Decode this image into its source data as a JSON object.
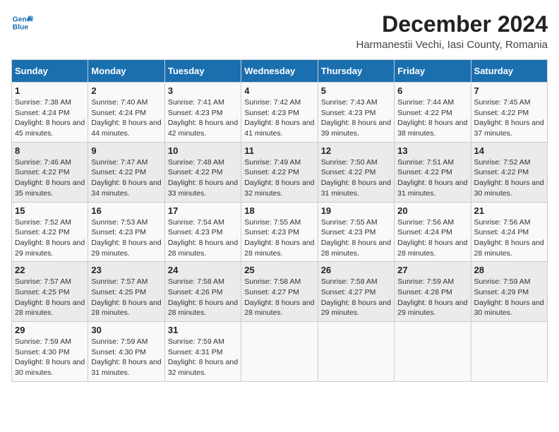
{
  "header": {
    "logo_line1": "General",
    "logo_line2": "Blue",
    "title": "December 2024",
    "subtitle": "Harmanestii Vechi, Iasi County, Romania"
  },
  "days_of_week": [
    "Sunday",
    "Monday",
    "Tuesday",
    "Wednesday",
    "Thursday",
    "Friday",
    "Saturday"
  ],
  "weeks": [
    [
      {
        "day": "1",
        "sunrise": "Sunrise: 7:38 AM",
        "sunset": "Sunset: 4:24 PM",
        "daylight": "Daylight: 8 hours and 45 minutes."
      },
      {
        "day": "2",
        "sunrise": "Sunrise: 7:40 AM",
        "sunset": "Sunset: 4:24 PM",
        "daylight": "Daylight: 8 hours and 44 minutes."
      },
      {
        "day": "3",
        "sunrise": "Sunrise: 7:41 AM",
        "sunset": "Sunset: 4:23 PM",
        "daylight": "Daylight: 8 hours and 42 minutes."
      },
      {
        "day": "4",
        "sunrise": "Sunrise: 7:42 AM",
        "sunset": "Sunset: 4:23 PM",
        "daylight": "Daylight: 8 hours and 41 minutes."
      },
      {
        "day": "5",
        "sunrise": "Sunrise: 7:43 AM",
        "sunset": "Sunset: 4:23 PM",
        "daylight": "Daylight: 8 hours and 39 minutes."
      },
      {
        "day": "6",
        "sunrise": "Sunrise: 7:44 AM",
        "sunset": "Sunset: 4:22 PM",
        "daylight": "Daylight: 8 hours and 38 minutes."
      },
      {
        "day": "7",
        "sunrise": "Sunrise: 7:45 AM",
        "sunset": "Sunset: 4:22 PM",
        "daylight": "Daylight: 8 hours and 37 minutes."
      }
    ],
    [
      {
        "day": "8",
        "sunrise": "Sunrise: 7:46 AM",
        "sunset": "Sunset: 4:22 PM",
        "daylight": "Daylight: 8 hours and 35 minutes."
      },
      {
        "day": "9",
        "sunrise": "Sunrise: 7:47 AM",
        "sunset": "Sunset: 4:22 PM",
        "daylight": "Daylight: 8 hours and 34 minutes."
      },
      {
        "day": "10",
        "sunrise": "Sunrise: 7:48 AM",
        "sunset": "Sunset: 4:22 PM",
        "daylight": "Daylight: 8 hours and 33 minutes."
      },
      {
        "day": "11",
        "sunrise": "Sunrise: 7:49 AM",
        "sunset": "Sunset: 4:22 PM",
        "daylight": "Daylight: 8 hours and 32 minutes."
      },
      {
        "day": "12",
        "sunrise": "Sunrise: 7:50 AM",
        "sunset": "Sunset: 4:22 PM",
        "daylight": "Daylight: 8 hours and 31 minutes."
      },
      {
        "day": "13",
        "sunrise": "Sunrise: 7:51 AM",
        "sunset": "Sunset: 4:22 PM",
        "daylight": "Daylight: 8 hours and 31 minutes."
      },
      {
        "day": "14",
        "sunrise": "Sunrise: 7:52 AM",
        "sunset": "Sunset: 4:22 PM",
        "daylight": "Daylight: 8 hours and 30 minutes."
      }
    ],
    [
      {
        "day": "15",
        "sunrise": "Sunrise: 7:52 AM",
        "sunset": "Sunset: 4:22 PM",
        "daylight": "Daylight: 8 hours and 29 minutes."
      },
      {
        "day": "16",
        "sunrise": "Sunrise: 7:53 AM",
        "sunset": "Sunset: 4:23 PM",
        "daylight": "Daylight: 8 hours and 29 minutes."
      },
      {
        "day": "17",
        "sunrise": "Sunrise: 7:54 AM",
        "sunset": "Sunset: 4:23 PM",
        "daylight": "Daylight: 8 hours and 28 minutes."
      },
      {
        "day": "18",
        "sunrise": "Sunrise: 7:55 AM",
        "sunset": "Sunset: 4:23 PM",
        "daylight": "Daylight: 8 hours and 28 minutes."
      },
      {
        "day": "19",
        "sunrise": "Sunrise: 7:55 AM",
        "sunset": "Sunset: 4:23 PM",
        "daylight": "Daylight: 8 hours and 28 minutes."
      },
      {
        "day": "20",
        "sunrise": "Sunrise: 7:56 AM",
        "sunset": "Sunset: 4:24 PM",
        "daylight": "Daylight: 8 hours and 28 minutes."
      },
      {
        "day": "21",
        "sunrise": "Sunrise: 7:56 AM",
        "sunset": "Sunset: 4:24 PM",
        "daylight": "Daylight: 8 hours and 28 minutes."
      }
    ],
    [
      {
        "day": "22",
        "sunrise": "Sunrise: 7:57 AM",
        "sunset": "Sunset: 4:25 PM",
        "daylight": "Daylight: 8 hours and 28 minutes."
      },
      {
        "day": "23",
        "sunrise": "Sunrise: 7:57 AM",
        "sunset": "Sunset: 4:25 PM",
        "daylight": "Daylight: 8 hours and 28 minutes."
      },
      {
        "day": "24",
        "sunrise": "Sunrise: 7:58 AM",
        "sunset": "Sunset: 4:26 PM",
        "daylight": "Daylight: 8 hours and 28 minutes."
      },
      {
        "day": "25",
        "sunrise": "Sunrise: 7:58 AM",
        "sunset": "Sunset: 4:27 PM",
        "daylight": "Daylight: 8 hours and 28 minutes."
      },
      {
        "day": "26",
        "sunrise": "Sunrise: 7:58 AM",
        "sunset": "Sunset: 4:27 PM",
        "daylight": "Daylight: 8 hours and 29 minutes."
      },
      {
        "day": "27",
        "sunrise": "Sunrise: 7:59 AM",
        "sunset": "Sunset: 4:28 PM",
        "daylight": "Daylight: 8 hours and 29 minutes."
      },
      {
        "day": "28",
        "sunrise": "Sunrise: 7:59 AM",
        "sunset": "Sunset: 4:29 PM",
        "daylight": "Daylight: 8 hours and 30 minutes."
      }
    ],
    [
      {
        "day": "29",
        "sunrise": "Sunrise: 7:59 AM",
        "sunset": "Sunset: 4:30 PM",
        "daylight": "Daylight: 8 hours and 30 minutes."
      },
      {
        "day": "30",
        "sunrise": "Sunrise: 7:59 AM",
        "sunset": "Sunset: 4:30 PM",
        "daylight": "Daylight: 8 hours and 31 minutes."
      },
      {
        "day": "31",
        "sunrise": "Sunrise: 7:59 AM",
        "sunset": "Sunset: 4:31 PM",
        "daylight": "Daylight: 8 hours and 32 minutes."
      },
      null,
      null,
      null,
      null
    ]
  ]
}
